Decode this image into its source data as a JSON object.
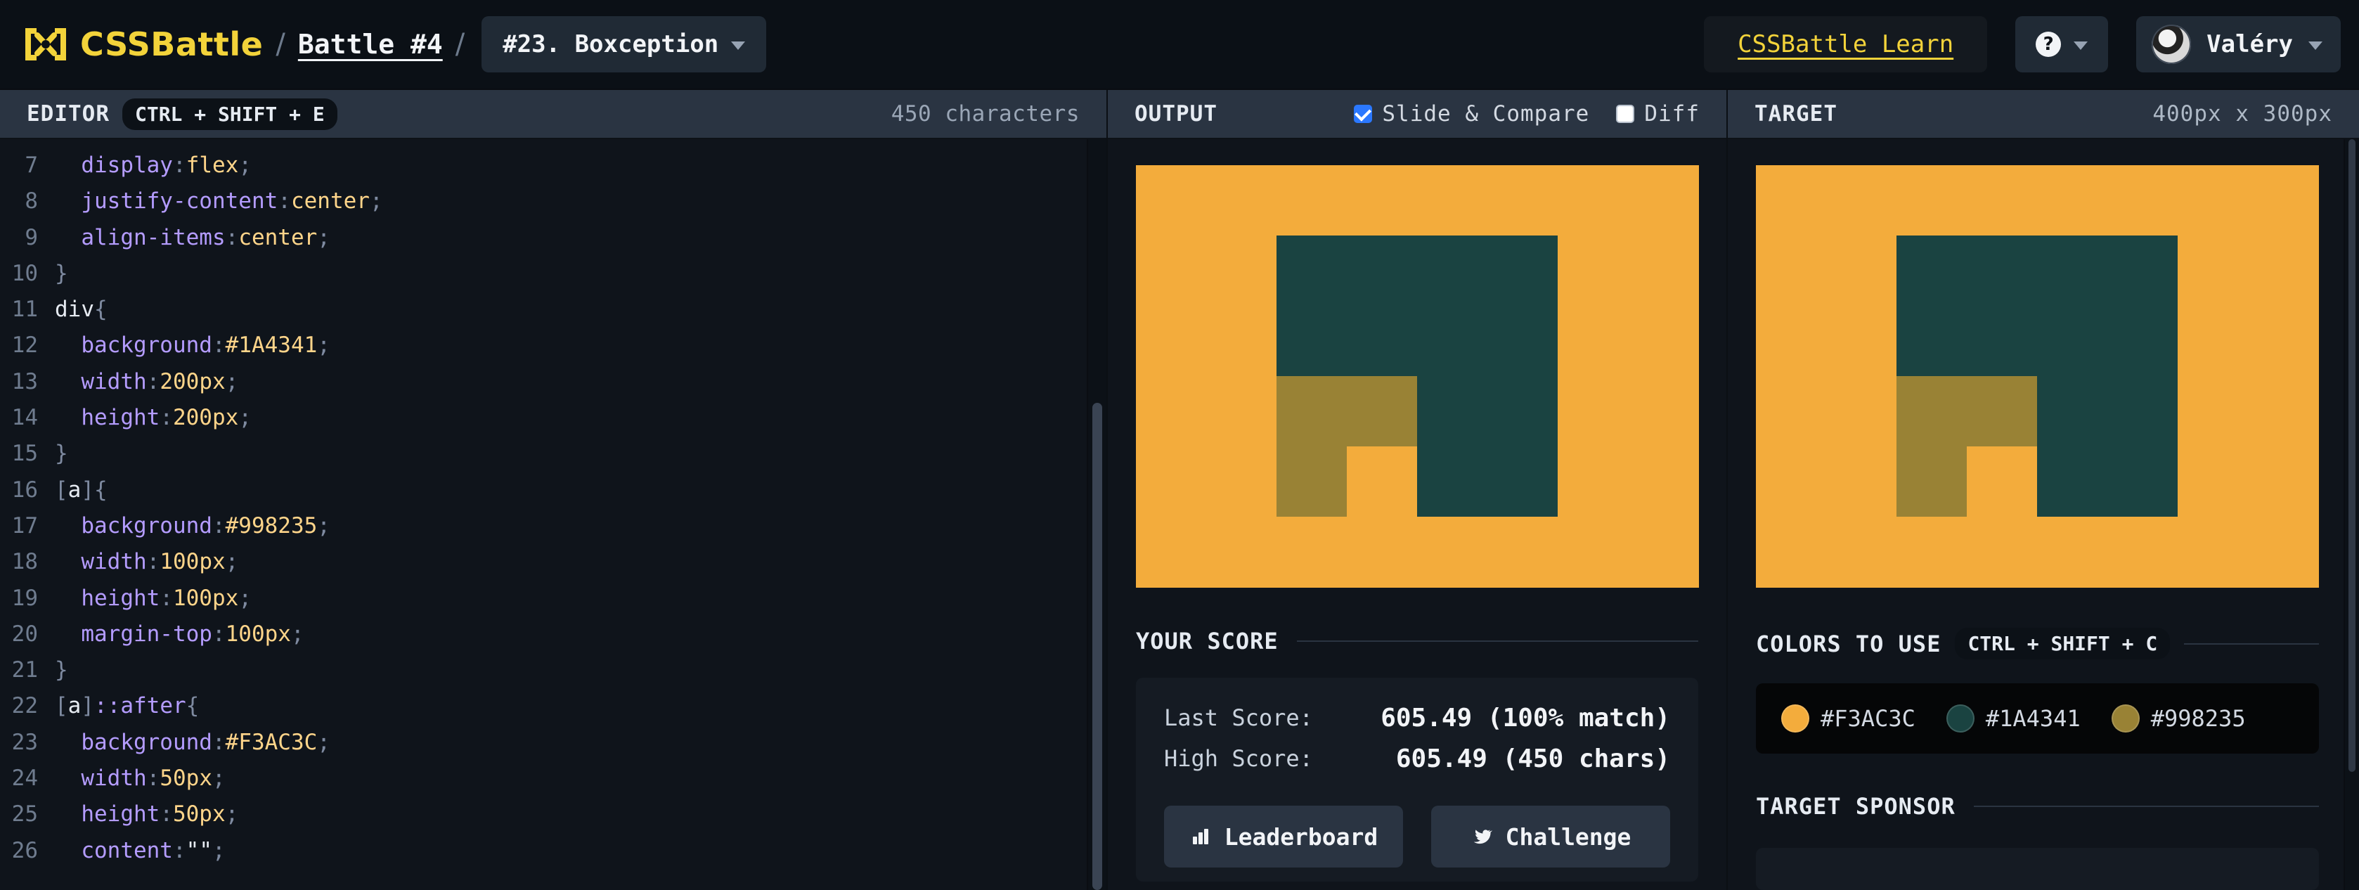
{
  "header": {
    "logo_text": "CSSBattle",
    "battle_link": "Battle #4",
    "level_title": "#23. Boxception",
    "learn_link": "CSSBattle Learn",
    "user_name": "Valéry"
  },
  "editor": {
    "title": "EDITOR",
    "shortcut": "CTRL + SHIFT + E",
    "char_count": "450 characters",
    "lines": [
      {
        "n": "7",
        "t": [
          [
            "  ",
            ""
          ],
          [
            "display",
            "prop"
          ],
          [
            ":",
            "punc"
          ],
          [
            "flex",
            "val"
          ],
          [
            ";",
            "punc"
          ]
        ]
      },
      {
        "n": "8",
        "t": [
          [
            "  ",
            ""
          ],
          [
            "justify-content",
            "prop"
          ],
          [
            ":",
            "punc"
          ],
          [
            "center",
            "val"
          ],
          [
            ";",
            "punc"
          ]
        ]
      },
      {
        "n": "9",
        "t": [
          [
            "  ",
            ""
          ],
          [
            "align-items",
            "prop"
          ],
          [
            ":",
            "punc"
          ],
          [
            "center",
            "val"
          ],
          [
            ";",
            "punc"
          ]
        ]
      },
      {
        "n": "10",
        "t": [
          [
            "}",
            "punc"
          ]
        ]
      },
      {
        "n": "11",
        "t": [
          [
            "div",
            "sel"
          ],
          [
            "{",
            "punc"
          ]
        ]
      },
      {
        "n": "12",
        "t": [
          [
            "  ",
            ""
          ],
          [
            "background",
            "prop"
          ],
          [
            ":",
            "punc"
          ],
          [
            "#1A4341",
            "val"
          ],
          [
            ";",
            "punc"
          ]
        ]
      },
      {
        "n": "13",
        "t": [
          [
            "  ",
            ""
          ],
          [
            "width",
            "prop"
          ],
          [
            ":",
            "punc"
          ],
          [
            "200px",
            "val"
          ],
          [
            ";",
            "punc"
          ]
        ]
      },
      {
        "n": "14",
        "t": [
          [
            "  ",
            ""
          ],
          [
            "height",
            "prop"
          ],
          [
            ":",
            "punc"
          ],
          [
            "200px",
            "val"
          ],
          [
            ";",
            "punc"
          ]
        ]
      },
      {
        "n": "15",
        "t": [
          [
            "}",
            "punc"
          ]
        ]
      },
      {
        "n": "16",
        "t": [
          [
            "[",
            "punc"
          ],
          [
            "a",
            "attr"
          ],
          [
            "]",
            "punc"
          ],
          [
            "{",
            "punc"
          ]
        ]
      },
      {
        "n": "17",
        "t": [
          [
            "  ",
            ""
          ],
          [
            "background",
            "prop"
          ],
          [
            ":",
            "punc"
          ],
          [
            "#998235",
            "val"
          ],
          [
            ";",
            "punc"
          ]
        ]
      },
      {
        "n": "18",
        "t": [
          [
            "  ",
            ""
          ],
          [
            "width",
            "prop"
          ],
          [
            ":",
            "punc"
          ],
          [
            "100px",
            "val"
          ],
          [
            ";",
            "punc"
          ]
        ]
      },
      {
        "n": "19",
        "t": [
          [
            "  ",
            ""
          ],
          [
            "height",
            "prop"
          ],
          [
            ":",
            "punc"
          ],
          [
            "100px",
            "val"
          ],
          [
            ";",
            "punc"
          ]
        ]
      },
      {
        "n": "20",
        "t": [
          [
            "  ",
            ""
          ],
          [
            "margin-top",
            "prop"
          ],
          [
            ":",
            "punc"
          ],
          [
            "100px",
            "val"
          ],
          [
            ";",
            "punc"
          ]
        ]
      },
      {
        "n": "21",
        "t": [
          [
            "}",
            "punc"
          ]
        ]
      },
      {
        "n": "22",
        "t": [
          [
            "[",
            "punc"
          ],
          [
            "a",
            "attr"
          ],
          [
            "]",
            "punc"
          ],
          [
            "::after",
            "pseudo"
          ],
          [
            "{",
            "punc"
          ]
        ]
      },
      {
        "n": "23",
        "t": [
          [
            "  ",
            ""
          ],
          [
            "background",
            "prop"
          ],
          [
            ":",
            "punc"
          ],
          [
            "#F3AC3C",
            "val"
          ],
          [
            ";",
            "punc"
          ]
        ]
      },
      {
        "n": "24",
        "t": [
          [
            "  ",
            ""
          ],
          [
            "width",
            "prop"
          ],
          [
            ":",
            "punc"
          ],
          [
            "50px",
            "val"
          ],
          [
            ";",
            "punc"
          ]
        ]
      },
      {
        "n": "25",
        "t": [
          [
            "  ",
            ""
          ],
          [
            "height",
            "prop"
          ],
          [
            ":",
            "punc"
          ],
          [
            "50px",
            "val"
          ],
          [
            ";",
            "punc"
          ]
        ]
      },
      {
        "n": "26",
        "t": [
          [
            "  ",
            ""
          ],
          [
            "content",
            "prop"
          ],
          [
            ":",
            "punc"
          ],
          [
            "\"\"",
            "str"
          ],
          [
            ";",
            "punc"
          ]
        ]
      }
    ]
  },
  "output": {
    "title": "OUTPUT",
    "slide_compare_label": "Slide & Compare",
    "slide_compare_checked": true,
    "diff_label": "Diff",
    "diff_checked": false
  },
  "score": {
    "title": "YOUR SCORE",
    "last_label": "Last Score:",
    "last_value": "605.49 (100% match)",
    "high_label": "High Score:",
    "high_value": "605.49 (450 chars)",
    "leaderboard_label": "Leaderboard",
    "challenge_label": "Challenge"
  },
  "target": {
    "title": "TARGET",
    "size": "400px x 300px",
    "colors_title": "COLORS TO USE",
    "colors_shortcut": "CTRL + SHIFT + C",
    "colors": [
      "#F3AC3C",
      "#1A4341",
      "#998235"
    ],
    "sponsor_title": "TARGET SPONSOR"
  }
}
